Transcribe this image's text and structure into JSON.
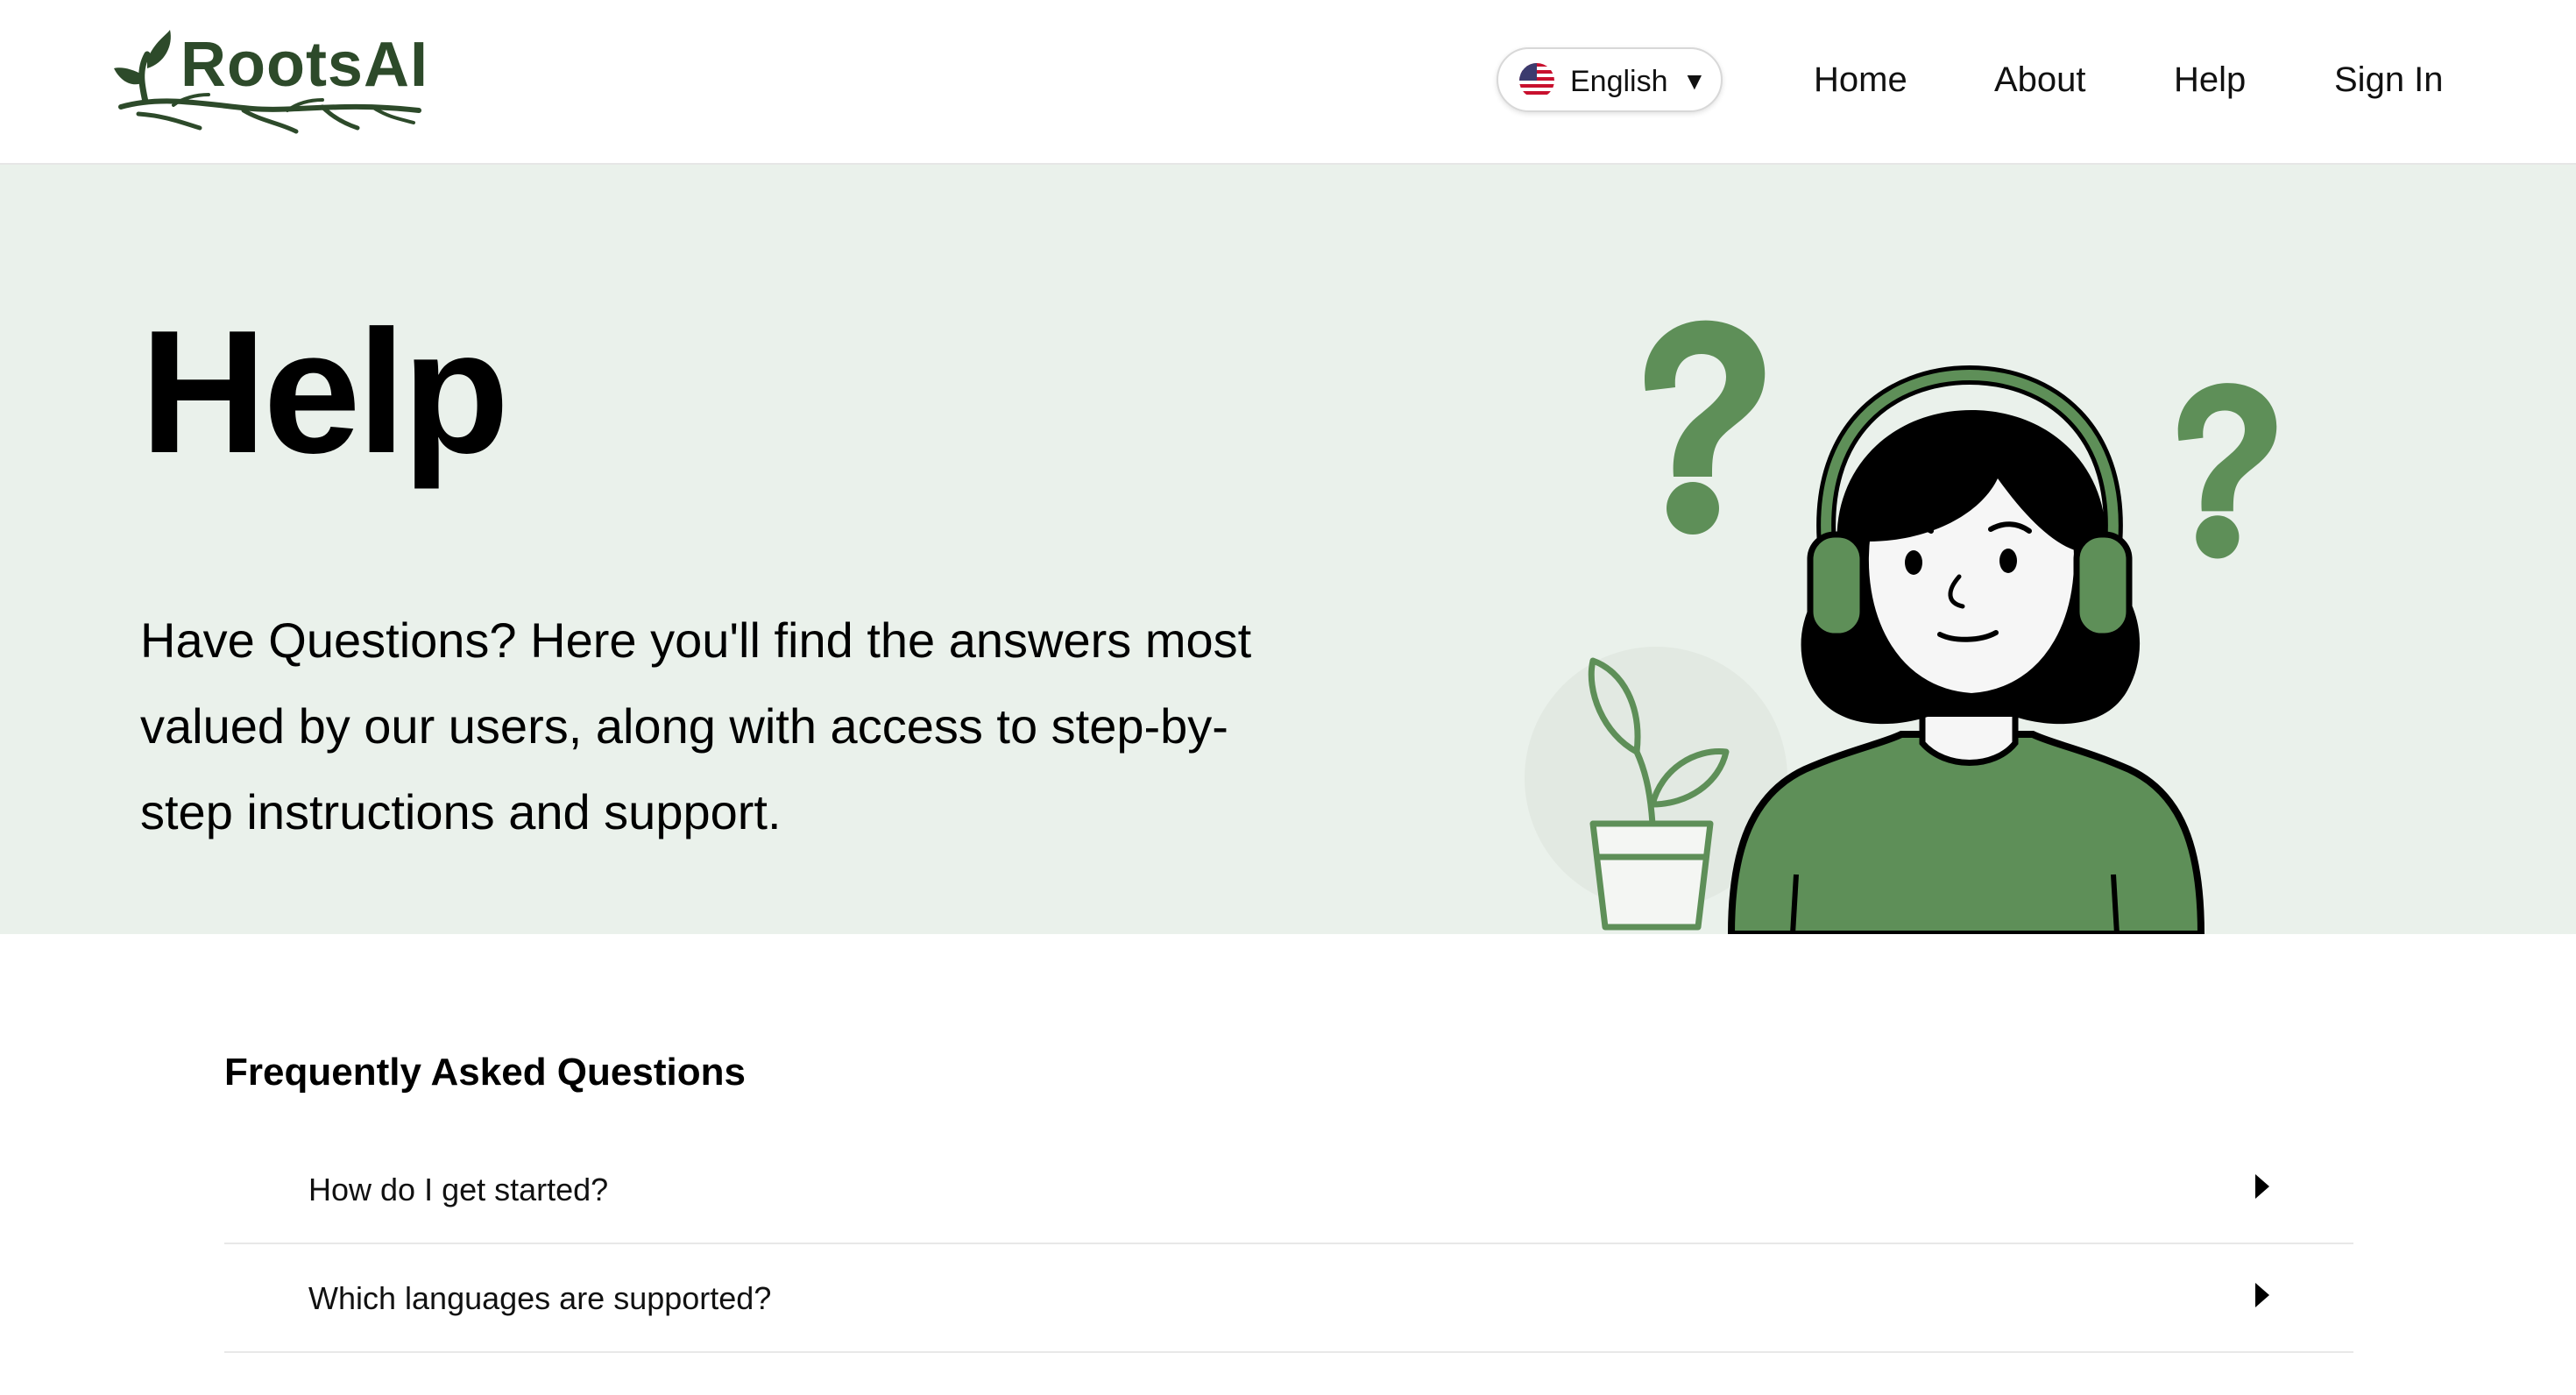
{
  "header": {
    "logo_text": "RootsAI",
    "language": {
      "label": "English",
      "flag_icon": "us-flag-icon",
      "caret_icon": "caret-down-icon"
    },
    "nav": [
      {
        "label": "Home"
      },
      {
        "label": "About"
      },
      {
        "label": "Help"
      },
      {
        "label": "Sign In"
      }
    ]
  },
  "hero": {
    "title": "Help",
    "description": "Have Questions? Here you'll find the answers most valued by our users, along with access to step-by-step instructions and support."
  },
  "faq": {
    "title": "Frequently Asked Questions",
    "items": [
      {
        "question": "How do I get started?"
      },
      {
        "question": "Which languages are supported?"
      }
    ]
  },
  "colors": {
    "brand_dark_green": "#2d4a2a",
    "accent_green": "#5e8f58",
    "hero_background": "#eaf1eb"
  }
}
